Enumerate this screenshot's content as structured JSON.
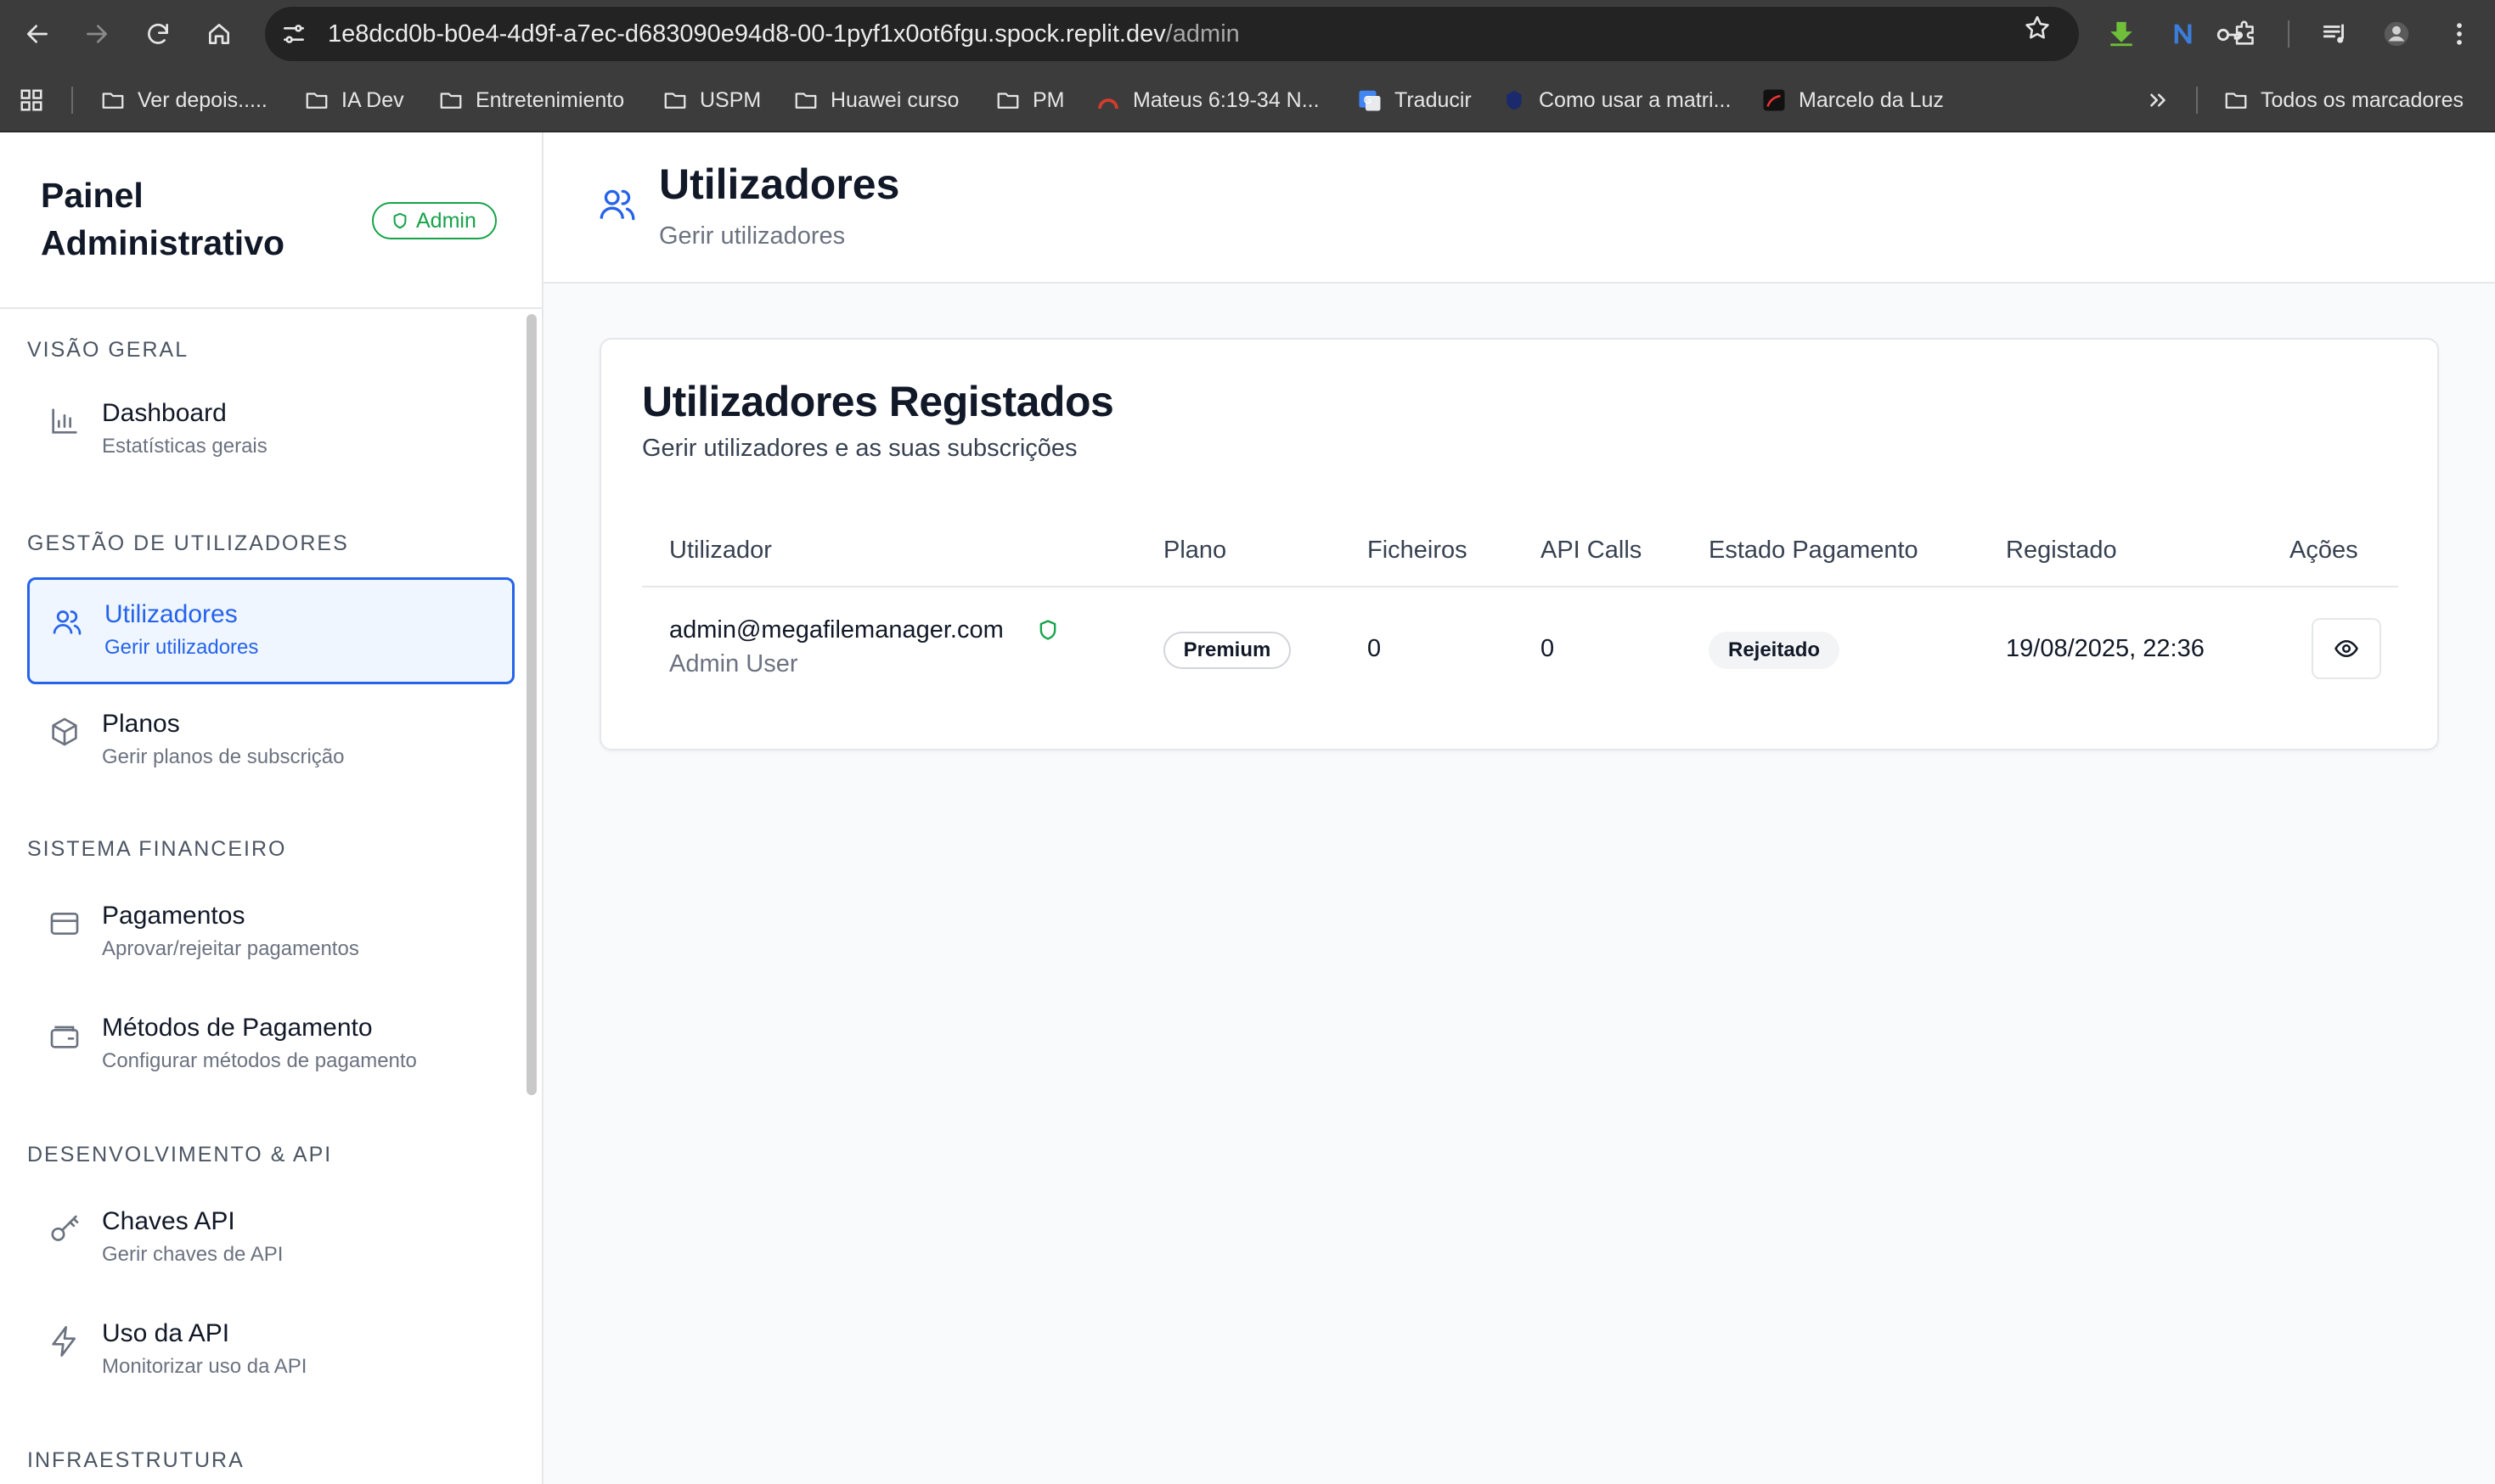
{
  "browser": {
    "url_host": "1e8dcd0b-b0e4-4d9f-a7ec-d683090e94d8-00-1pyf1x0ot6fgu.spock.replit.dev",
    "url_path": "/admin",
    "bookmarks": [
      {
        "label": "Ver depois.....",
        "icon": "folder-icon"
      },
      {
        "label": "IA Dev",
        "icon": "folder-icon"
      },
      {
        "label": "Entretenimiento",
        "icon": "folder-icon"
      },
      {
        "label": "USPM",
        "icon": "folder-icon"
      },
      {
        "label": "Huawei curso",
        "icon": "folder-icon"
      },
      {
        "label": "PM",
        "icon": "folder-icon"
      },
      {
        "label": "Mateus 6:19-34 N...",
        "icon": "site-favicon",
        "color": "#d43c2c"
      },
      {
        "label": "Traducir",
        "icon": "translate-favicon",
        "color": "#4285f4"
      },
      {
        "label": "Como usar a matri...",
        "icon": "site-favicon",
        "color": "#1a2a6c"
      },
      {
        "label": "Marcelo da Luz",
        "icon": "site-favicon",
        "color": "#111111"
      }
    ],
    "all_bookmarks": "Todos os marcadores"
  },
  "sidebar": {
    "title": "Painel Administrativo",
    "badge": "Admin",
    "sections": [
      {
        "label": "VISÃO GERAL",
        "items": [
          {
            "title": "Dashboard",
            "subtitle": "Estatísticas gerais",
            "icon": "bar-chart-icon"
          }
        ]
      },
      {
        "label": "GESTÃO DE UTILIZADORES",
        "items": [
          {
            "title": "Utilizadores",
            "subtitle": "Gerir utilizadores",
            "icon": "users-icon",
            "active": true
          },
          {
            "title": "Planos",
            "subtitle": "Gerir planos de subscrição",
            "icon": "package-icon"
          }
        ]
      },
      {
        "label": "SISTEMA FINANCEIRO",
        "items": [
          {
            "title": "Pagamentos",
            "subtitle": "Aprovar/rejeitar pagamentos",
            "icon": "credit-card-icon"
          },
          {
            "title": "Métodos de Pagamento",
            "subtitle": "Configurar métodos de pagamento",
            "icon": "wallet-icon"
          }
        ]
      },
      {
        "label": "DESENVOLVIMENTO & API",
        "items": [
          {
            "title": "Chaves API",
            "subtitle": "Gerir chaves de API",
            "icon": "key-icon"
          },
          {
            "title": "Uso da API",
            "subtitle": "Monitorizar uso da API",
            "icon": "zap-icon"
          }
        ]
      },
      {
        "label": "INFRAESTRUTURA",
        "items": []
      }
    ]
  },
  "header": {
    "title": "Utilizadores",
    "subtitle": "Gerir utilizadores"
  },
  "card": {
    "title": "Utilizadores Registados",
    "subtitle": "Gerir utilizadores e as suas subscrições",
    "columns": [
      "Utilizador",
      "Plano",
      "Ficheiros",
      "API Calls",
      "Estado Pagamento",
      "Registado",
      "Ações"
    ],
    "rows": [
      {
        "email": "admin@megafilemanager.com",
        "name": "Admin User",
        "plan": "Premium",
        "files": "0",
        "api_calls": "0",
        "payment_status": "Rejeitado",
        "registered": "19/08/2025, 22:36"
      }
    ]
  },
  "colors": {
    "accent": "#2563eb",
    "admin_badge": "#16a34a",
    "browser_chrome": "#3c3c3c"
  }
}
